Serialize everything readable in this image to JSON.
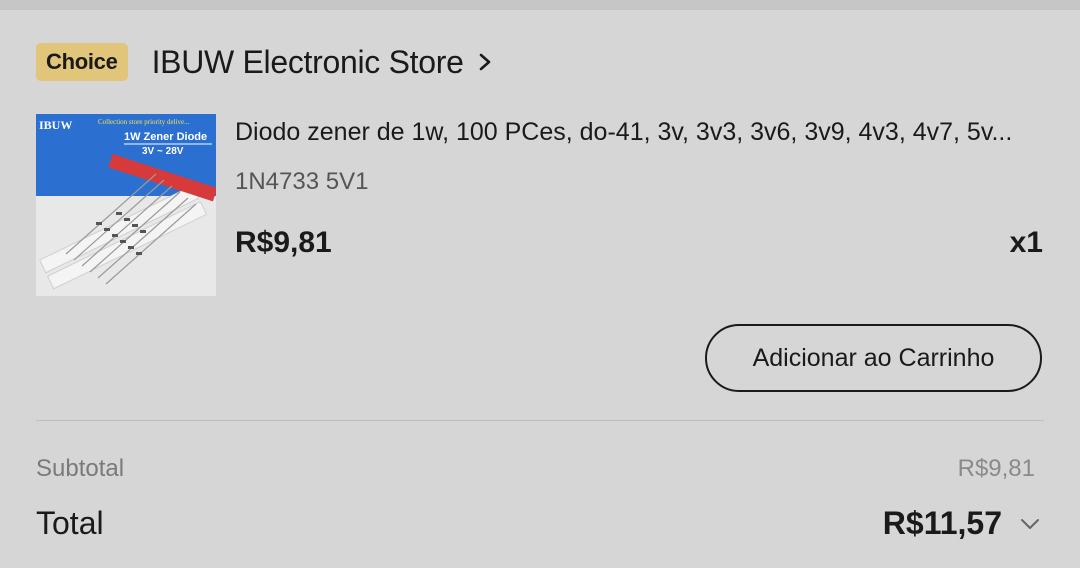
{
  "store": {
    "badge": "Choice",
    "name": "IBUW Electronic Store"
  },
  "product": {
    "image_brand": "IBUW",
    "image_banner": "Collection store priority delive...",
    "image_title": "1W Zener Diode",
    "image_range": "3V ~ 28V",
    "title": "Diodo zener de 1w, 100 PCes, do-41, 3v, 3v3, 3v6, 3v9, 4v3, 4v7, 5v...",
    "variant": "1N4733 5V1",
    "price": "R$9,81",
    "quantity": "x1"
  },
  "actions": {
    "add_to_cart": "Adicionar ao Carrinho"
  },
  "summary": {
    "subtotal_label": "Subtotal",
    "subtotal_value": "R$9,81",
    "total_label": "Total",
    "total_value": "R$11,57"
  },
  "colors": {
    "background": "#d6d6d6",
    "choice_badge": "#e0c57a",
    "product_box_blue": "#2b6fd1",
    "tape_red": "#d63a3a"
  },
  "icons": {
    "store_chevron": "chevron-right-icon",
    "total_chevron": "chevron-down-icon"
  }
}
